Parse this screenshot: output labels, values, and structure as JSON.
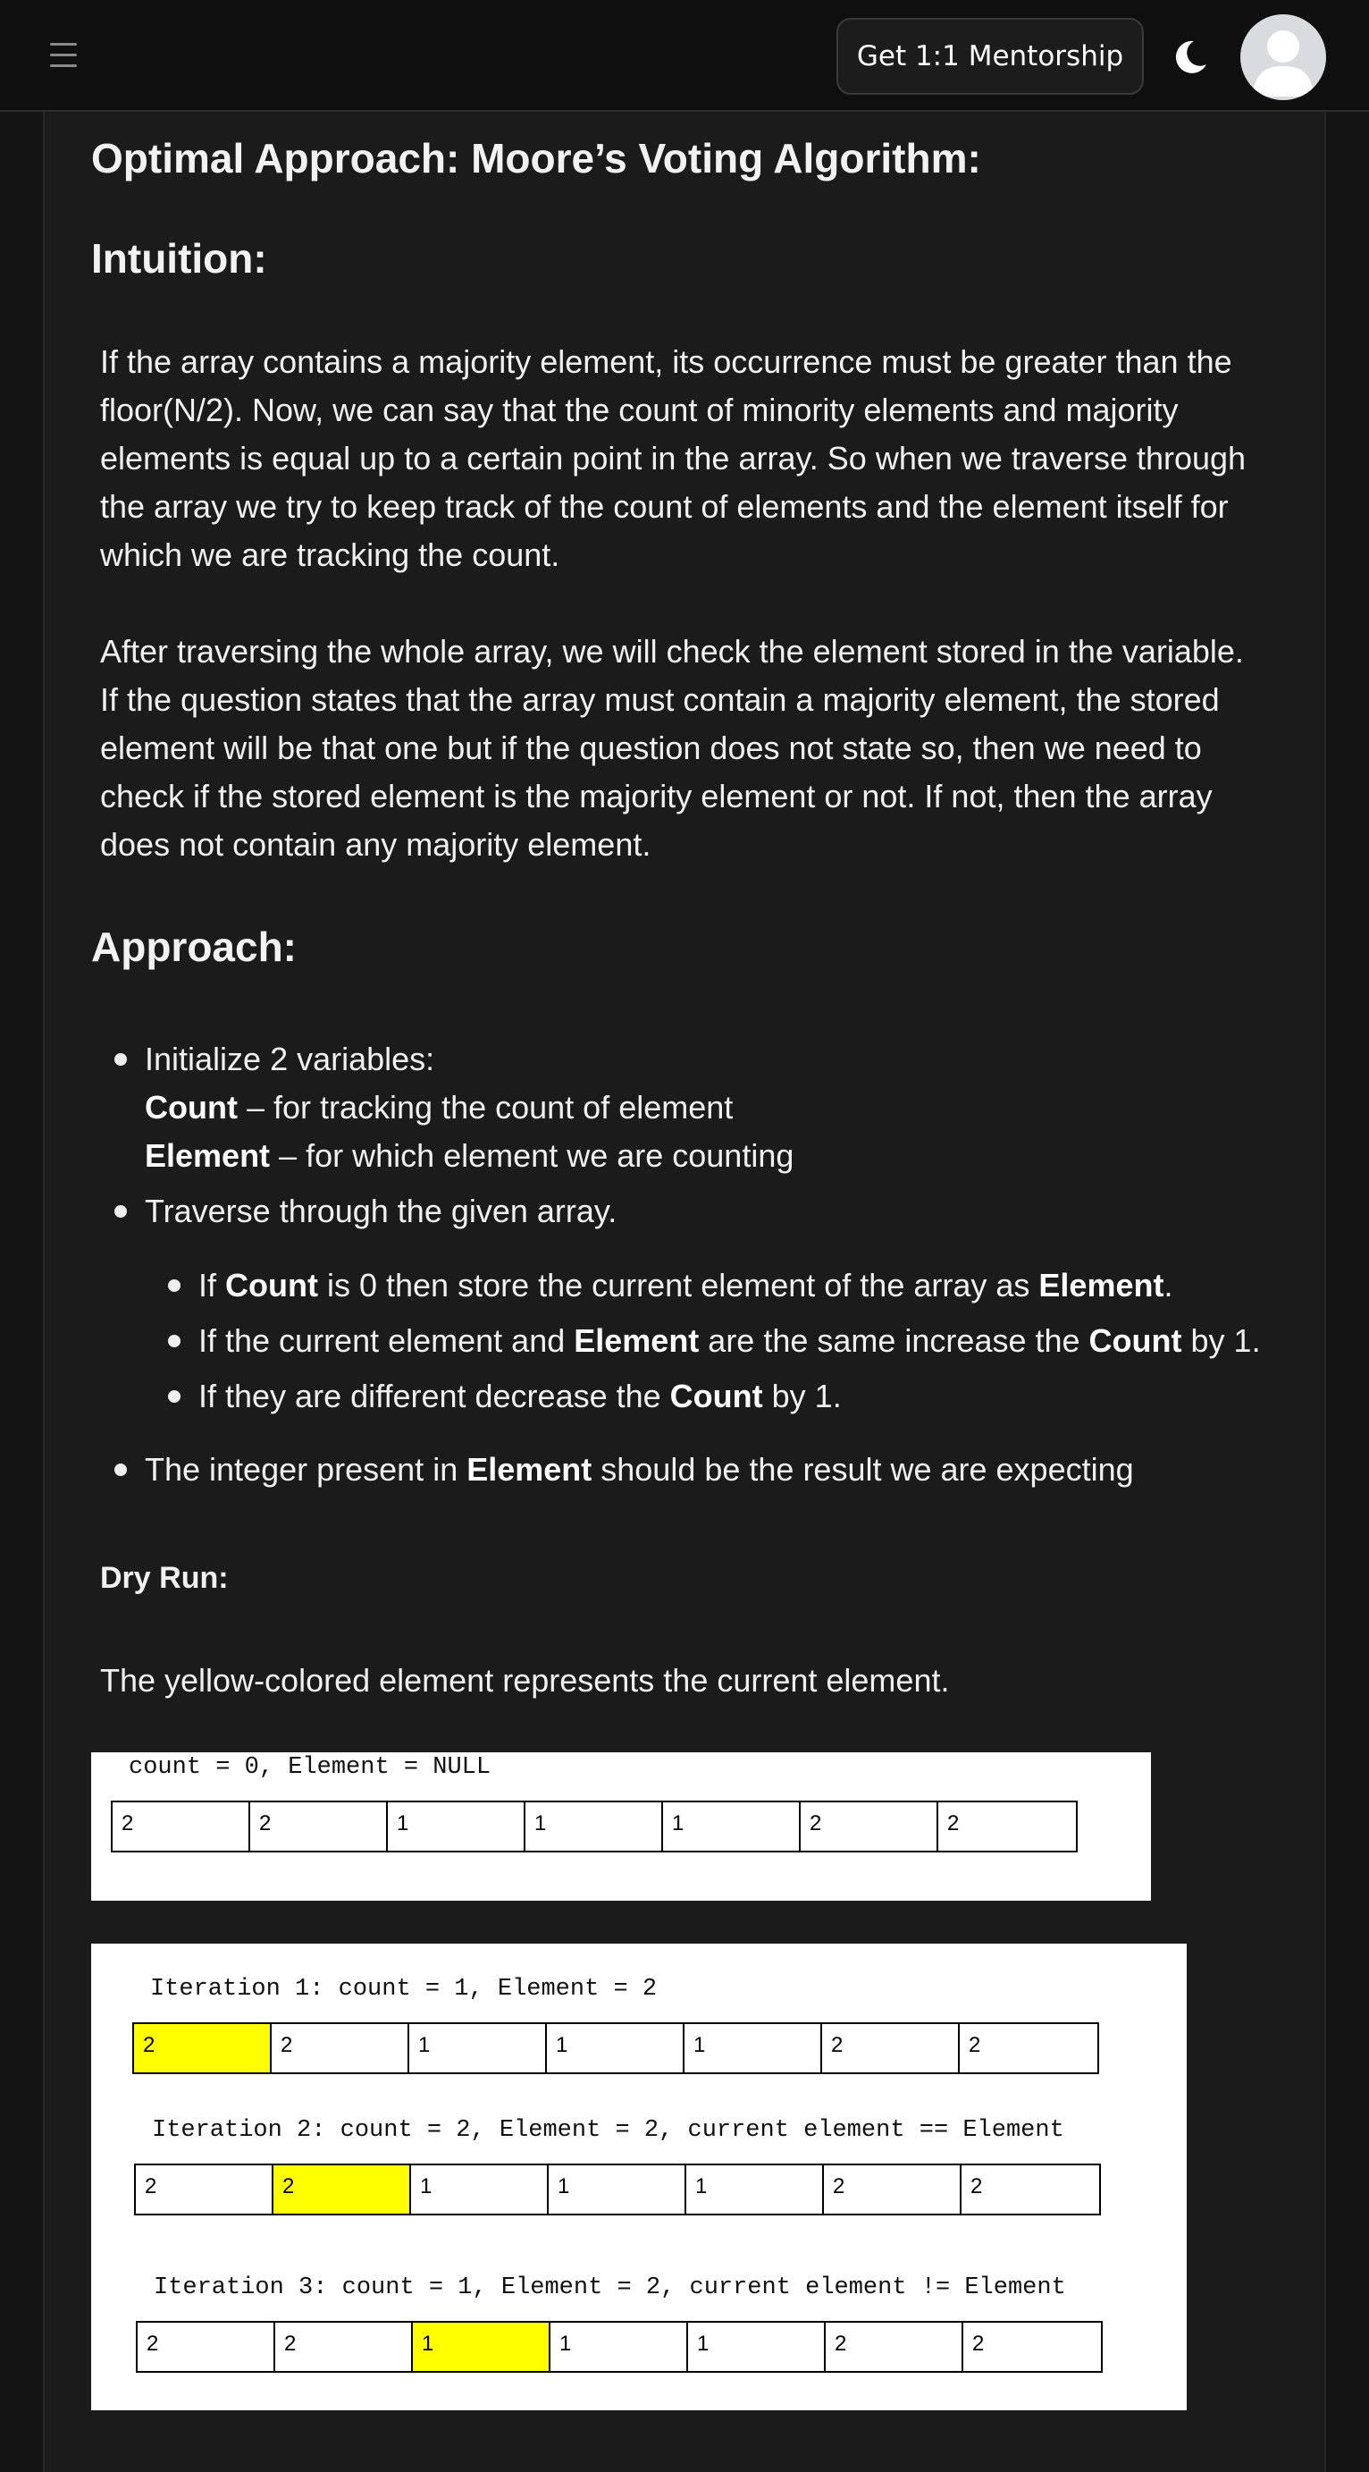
{
  "header": {
    "menu_icon": "hamburger-icon",
    "mentorship_button": "Get 1:1 Mentorship",
    "theme_icon": "moon-icon",
    "avatar_icon": "user-avatar-icon"
  },
  "article": {
    "title": "Optimal Approach: Moore’s Voting Algorithm:",
    "intuition_heading": "Intuition:",
    "intuition_p1": "If the array contains a majority element, its occurrence must be greater than the floor(N/2). Now, we can say that the count of minority elements and majority elements is equal up to a certain point in the array. So when we traverse through the array we try to keep track of the count of elements and the element itself for which we are tracking the count.",
    "intuition_p2": "After traversing the whole array, we will check the element stored in the variable. If the question states that the array must contain a majority element, the stored element will be that one but if the question does not state so, then we need to check if the stored element is the majority element or not. If not, then the array does not contain any majority element.",
    "approach_heading": "Approach:",
    "bullet1_intro": "Initialize 2 variables:",
    "bullet1_count_label": "Count",
    "bullet1_count_desc": " –  for tracking the count of element",
    "bullet1_element_label": "Element",
    "bullet1_element_desc": " – for which element we are counting",
    "bullet2": "Traverse through the given array.",
    "sub1_pre": "If ",
    "sub1_b1": "Count",
    "sub1_mid": " is 0 then store the current element of the array as ",
    "sub1_b2": "Element",
    "sub1_end": ".",
    "sub2_pre": "If the current element and ",
    "sub2_b1": "Element",
    "sub2_mid": " are the same increase the ",
    "sub2_b2": "Count",
    "sub2_end": " by 1.",
    "sub3_pre": "If they are different decrease the ",
    "sub3_b1": "Count",
    "sub3_end": " by 1.",
    "bullet3_pre": "The integer present in ",
    "bullet3_b": "Element",
    "bullet3_end": " should be the result we are expecting",
    "dry_run_heading": "Dry Run:",
    "dry_run_note": "The yellow-colored element represents the current element."
  },
  "figures": {
    "initial": {
      "caption": "count = 0, Element = NULL",
      "cells": [
        "2",
        "2",
        "1",
        "1",
        "1",
        "2",
        "2"
      ]
    },
    "iterations": [
      {
        "caption": "Iteration 1: count = 1, Element = 2",
        "cells": [
          "2",
          "2",
          "1",
          "1",
          "1",
          "2",
          "2"
        ],
        "highlight_index": 0
      },
      {
        "caption": "Iteration 2: count = 2, Element = 2, current element == Element",
        "cells": [
          "2",
          "2",
          "1",
          "1",
          "1",
          "2",
          "2"
        ],
        "highlight_index": 1
      },
      {
        "caption": "Iteration 3: count = 1, Element = 2, current element != Element",
        "cells": [
          "2",
          "2",
          "1",
          "1",
          "1",
          "2",
          "2"
        ],
        "highlight_index": 2
      }
    ],
    "highlight_color": "#ffff00"
  }
}
